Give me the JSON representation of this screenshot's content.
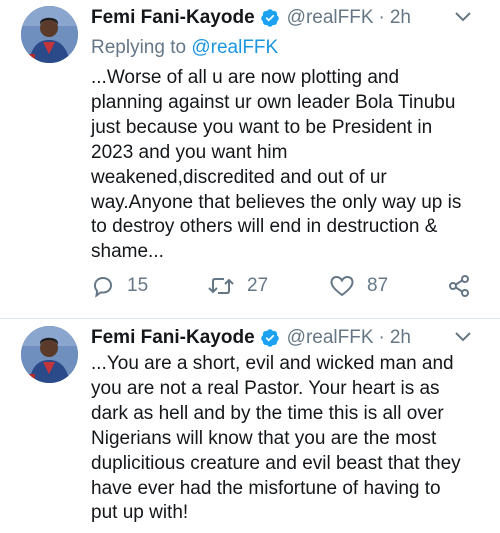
{
  "tweets": [
    {
      "author": {
        "name": "Femi Fani-Kayode",
        "handle": "@realFFK",
        "separator": "·",
        "time": "2h",
        "verified": true
      },
      "replying_prefix": "Replying to ",
      "replying_to": "@realFFK",
      "lines": [
        "...Worse of all u are now plotting and",
        "planning against ur own leader Bola Tinubu",
        "just because you want to be President in",
        "2023 and you want him",
        "weakened,discredited and out of ur",
        "way.Anyone that believes the only way up is",
        "to destroy others will end in destruction &",
        "shame..."
      ],
      "actions": {
        "replies": "15",
        "retweets": "27",
        "likes": "87"
      }
    },
    {
      "author": {
        "name": "Femi Fani-Kayode",
        "handle": "@realFFK",
        "separator": "·",
        "time": "2h",
        "verified": true
      },
      "lines": [
        "...You are a short, evil and wicked man and",
        "you are not a real Pastor. Your heart is as",
        "dark as hell and by the time this is all over",
        "Nigerians will know that you are the most",
        "duplicitious creature and evil beast that they",
        "have ever had the misfortune of having to",
        "put up with!"
      ]
    }
  ],
  "icons": {
    "verified": "verified-badge-icon",
    "menu": "chevron-down-icon",
    "reply": "reply-icon",
    "retweet": "retweet-icon",
    "like": "heart-icon",
    "share": "share-icon"
  },
  "colors": {
    "text": "#14171a",
    "secondary": "#657786",
    "link": "#1b95e0",
    "verified": "#1da1f2",
    "divider": "#e1e8ed"
  }
}
